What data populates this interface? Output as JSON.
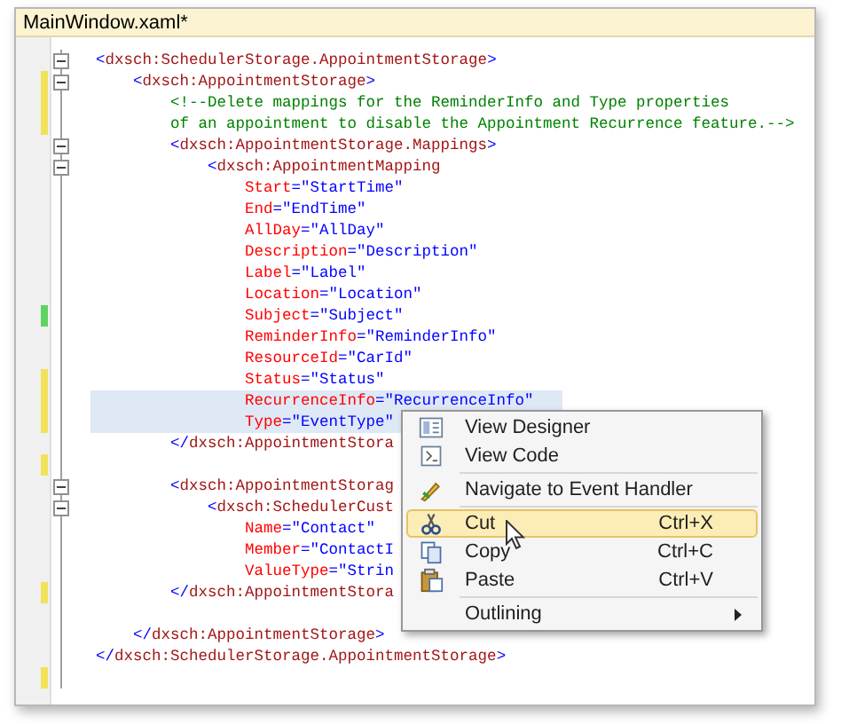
{
  "window": {
    "title": "MainWindow.xaml*"
  },
  "editor": {
    "lines": [
      {
        "fold": true,
        "selected": false,
        "tokens": [
          {
            "kind": "punct",
            "text": "<"
          },
          {
            "kind": "element",
            "text": "dxsch:SchedulerStorage.AppointmentStorage"
          },
          {
            "kind": "punct",
            "text": ">"
          }
        ],
        "children": [
          {
            "fold": true,
            "selected": false,
            "color": "#f2e25a",
            "tokens": [
              {
                "kind": "punct",
                "text": "<"
              },
              {
                "kind": "element",
                "text": "dxsch:AppointmentStorage"
              },
              {
                "kind": "punct",
                "text": ">"
              }
            ],
            "children": [
              {
                "fold": false,
                "selected": false,
                "color": "#f2e25a",
                "tokens": [
                  {
                    "kind": "comment",
                    "text": "<!--Delete mappings for the ReminderInfo and Type properties"
                  }
                ]
              },
              {
                "fold": false,
                "selected": false,
                "color": "#f2e25a",
                "tokens": [
                  {
                    "kind": "comment",
                    "text": "of an appointment to disable the Appointment Recurrence feature.-->"
                  }
                ]
              },
              {
                "fold": true,
                "selected": false,
                "tokens": [
                  {
                    "kind": "punct",
                    "text": "<"
                  },
                  {
                    "kind": "element",
                    "text": "dxsch:AppointmentStorage.Mappings"
                  },
                  {
                    "kind": "punct",
                    "text": ">"
                  }
                ],
                "children": [
                  {
                    "fold": true,
                    "selected": false,
                    "tokens": [
                      {
                        "kind": "punct",
                        "text": "<"
                      },
                      {
                        "kind": "element",
                        "text": "dxsch:AppointmentMapping"
                      }
                    ],
                    "children": [
                      {
                        "fold": false,
                        "selected": false,
                        "tokens": [
                          {
                            "kind": "attr",
                            "text": "Start"
                          },
                          {
                            "kind": "punct",
                            "text": "="
                          },
                          {
                            "kind": "value",
                            "text": "\"StartTime\""
                          }
                        ]
                      },
                      {
                        "fold": false,
                        "selected": false,
                        "tokens": [
                          {
                            "kind": "attr",
                            "text": "End"
                          },
                          {
                            "kind": "punct",
                            "text": "="
                          },
                          {
                            "kind": "value",
                            "text": "\"EndTime\""
                          }
                        ]
                      },
                      {
                        "fold": false,
                        "selected": false,
                        "tokens": [
                          {
                            "kind": "attr",
                            "text": "AllDay"
                          },
                          {
                            "kind": "punct",
                            "text": "="
                          },
                          {
                            "kind": "value",
                            "text": "\"AllDay\""
                          }
                        ]
                      },
                      {
                        "fold": false,
                        "selected": false,
                        "tokens": [
                          {
                            "kind": "attr",
                            "text": "Description"
                          },
                          {
                            "kind": "punct",
                            "text": "="
                          },
                          {
                            "kind": "value",
                            "text": "\"Description\""
                          }
                        ]
                      },
                      {
                        "fold": false,
                        "selected": false,
                        "tokens": [
                          {
                            "kind": "attr",
                            "text": "Label"
                          },
                          {
                            "kind": "punct",
                            "text": "="
                          },
                          {
                            "kind": "value",
                            "text": "\"Label\""
                          }
                        ]
                      },
                      {
                        "fold": false,
                        "selected": false,
                        "tokens": [
                          {
                            "kind": "attr",
                            "text": "Location"
                          },
                          {
                            "kind": "punct",
                            "text": "="
                          },
                          {
                            "kind": "value",
                            "text": "\"Location\""
                          }
                        ]
                      },
                      {
                        "fold": false,
                        "selected": false,
                        "color": "#5fd35f",
                        "tokens": [
                          {
                            "kind": "attr",
                            "text": "Subject"
                          },
                          {
                            "kind": "punct",
                            "text": "="
                          },
                          {
                            "kind": "value",
                            "text": "\"Subject\""
                          }
                        ]
                      },
                      {
                        "fold": false,
                        "selected": false,
                        "tokens": [
                          {
                            "kind": "attr",
                            "text": "ReminderInfo"
                          },
                          {
                            "kind": "punct",
                            "text": "="
                          },
                          {
                            "kind": "value",
                            "text": "\"ReminderInfo\""
                          }
                        ]
                      },
                      {
                        "fold": false,
                        "selected": false,
                        "tokens": [
                          {
                            "kind": "attr",
                            "text": "ResourceId"
                          },
                          {
                            "kind": "punct",
                            "text": "="
                          },
                          {
                            "kind": "value",
                            "text": "\"CarId\""
                          }
                        ]
                      },
                      {
                        "fold": false,
                        "selected": false,
                        "color": "#f2e25a",
                        "tokens": [
                          {
                            "kind": "attr",
                            "text": "Status"
                          },
                          {
                            "kind": "punct",
                            "text": "="
                          },
                          {
                            "kind": "value",
                            "text": "\"Status\""
                          }
                        ]
                      },
                      {
                        "fold": false,
                        "selected": true,
                        "color": "#f2e25a",
                        "tokens": [
                          {
                            "kind": "attr",
                            "text": "RecurrenceInfo"
                          },
                          {
                            "kind": "punct",
                            "text": "="
                          },
                          {
                            "kind": "value",
                            "text": "\"RecurrenceInfo\""
                          }
                        ]
                      },
                      {
                        "fold": false,
                        "selected": true,
                        "color": "#f2e25a",
                        "tokens": [
                          {
                            "kind": "attr",
                            "text": "Type"
                          },
                          {
                            "kind": "punct",
                            "text": "="
                          },
                          {
                            "kind": "value",
                            "text": "\"EventType\""
                          }
                        ]
                      }
                    ]
                  }
                ]
              },
              {
                "fold": false,
                "selected": false,
                "tokens": [
                  {
                    "kind": "punct",
                    "text": "</"
                  },
                  {
                    "kind": "element",
                    "text": "dxsch:AppointmentStora"
                  }
                ]
              },
              {
                "fold": false,
                "selected": false,
                "color": "#f2e25a"
              },
              {
                "fold": true,
                "selected": false,
                "tokens": [
                  {
                    "kind": "punct",
                    "text": "<"
                  },
                  {
                    "kind": "element",
                    "text": "dxsch:AppointmentStorag"
                  }
                ],
                "children": [
                  {
                    "fold": true,
                    "selected": false,
                    "tokens": [
                      {
                        "kind": "punct",
                        "text": "<"
                      },
                      {
                        "kind": "element",
                        "text": "dxsch:SchedulerCust"
                      }
                    ],
                    "children": [
                      {
                        "fold": false,
                        "selected": false,
                        "tokens": [
                          {
                            "kind": "attr",
                            "text": "Name"
                          },
                          {
                            "kind": "punct",
                            "text": "="
                          },
                          {
                            "kind": "value",
                            "text": "\"Contact\""
                          }
                        ]
                      },
                      {
                        "fold": false,
                        "selected": false,
                        "tokens": [
                          {
                            "kind": "attr",
                            "text": "Member"
                          },
                          {
                            "kind": "punct",
                            "text": "="
                          },
                          {
                            "kind": "value",
                            "text": "\"ContactI"
                          }
                        ]
                      },
                      {
                        "fold": false,
                        "selected": false,
                        "tokens": [
                          {
                            "kind": "attr",
                            "text": "ValueType"
                          },
                          {
                            "kind": "punct",
                            "text": "="
                          },
                          {
                            "kind": "value",
                            "text": "\"Strin"
                          }
                        ]
                      }
                    ]
                  }
                ]
              },
              {
                "fold": false,
                "selected": false,
                "color": "#f2e25a",
                "tokens": [
                  {
                    "kind": "punct",
                    "text": "</"
                  },
                  {
                    "kind": "element",
                    "text": "dxsch:AppointmentStora"
                  }
                ]
              },
              {
                "fold": false,
                "selected": false
              }
            ]
          },
          {
            "fold": false,
            "selected": false,
            "tokens": [
              {
                "kind": "punct",
                "text": "</"
              },
              {
                "kind": "element",
                "text": "dxsch:AppointmentStorage"
              },
              {
                "kind": "punct",
                "text": ">"
              }
            ]
          }
        ]
      },
      {
        "fold": false,
        "selected": false,
        "tokens": [
          {
            "kind": "punct",
            "text": "</"
          },
          {
            "kind": "element",
            "text": "dxsch:SchedulerStorage.AppointmentStorage"
          },
          {
            "kind": "punct",
            "text": ">"
          }
        ]
      },
      {
        "fold": false,
        "selected": false,
        "color": "#f2e25a"
      }
    ]
  },
  "context_menu": {
    "items": [
      {
        "kind": "item",
        "label": "View Designer",
        "selected": false
      },
      {
        "kind": "item",
        "label": "View Code",
        "selected": false
      },
      {
        "kind": "separator"
      },
      {
        "kind": "item",
        "label": "Navigate to Event Handler",
        "selected": false
      },
      {
        "kind": "separator"
      },
      {
        "kind": "item",
        "label": "Cut",
        "shortcut": "Ctrl+X",
        "selected": true
      },
      {
        "kind": "item",
        "label": "Copy",
        "shortcut": "Ctrl+C",
        "selected": false
      },
      {
        "kind": "item",
        "label": "Paste",
        "shortcut": "Ctrl+V",
        "selected": false
      },
      {
        "kind": "separator"
      },
      {
        "kind": "item",
        "label": "Outlining",
        "submenu": true,
        "selected": false
      }
    ]
  }
}
